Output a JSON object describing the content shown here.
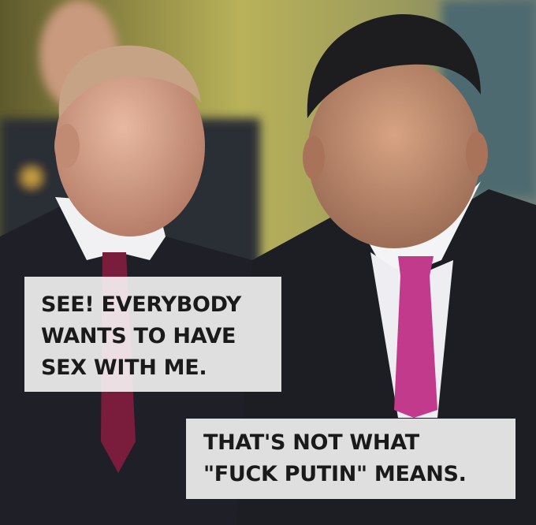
{
  "image": {
    "description_icon": "meme-photo"
  },
  "captions": {
    "left": {
      "lines": [
        "SEE! EVERYBODY",
        "WANTS TO HAVE",
        "SEX WITH ME."
      ]
    },
    "right": {
      "lines": [
        "THAT'S NOT WHAT",
        "\"FUCK PUTIN\" MEANS."
      ]
    }
  },
  "colors": {
    "caption_bg": "#ffffff",
    "caption_text": "#1a1a1a",
    "left_tie": "#7a1d3c",
    "right_tie": "#c23a8c",
    "suit": "#1c1e24"
  }
}
